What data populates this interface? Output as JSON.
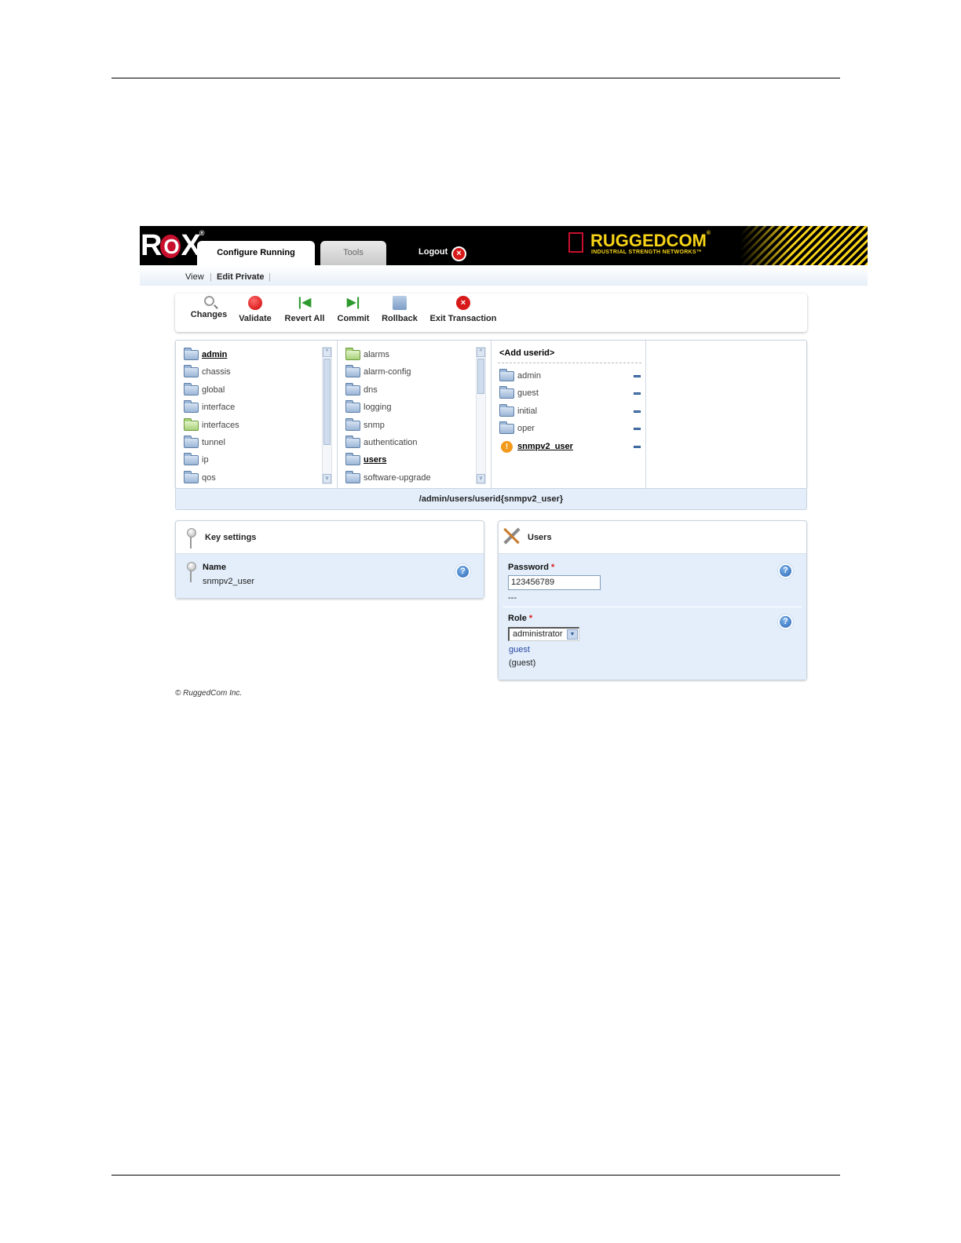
{
  "header": {
    "logo": {
      "text_left": "R",
      "text_o": "O",
      "text_right": "X",
      "mark": "®"
    },
    "tabs": [
      {
        "label": "Configure Running",
        "active": true
      },
      {
        "label": "Tools",
        "active": false
      }
    ],
    "logout_label": "Logout",
    "brand_name": "RUGGEDCOM",
    "brand_mark": "®",
    "brand_tagline": "INDUSTRIAL STRENGTH NETWORKS™"
  },
  "subnav": {
    "items": [
      "View",
      "Edit Private"
    ],
    "separator": "|"
  },
  "toolbar": {
    "buttons": [
      {
        "label": "Changes",
        "icon": "magnifier-icon"
      },
      {
        "label": "Validate",
        "icon": "validate-icon"
      },
      {
        "label": "Revert All",
        "icon": "revert-icon"
      },
      {
        "label": "Commit",
        "icon": "commit-icon"
      },
      {
        "label": "Rollback",
        "icon": "rollback-icon"
      },
      {
        "label": "Exit Transaction",
        "icon": "exit-icon"
      }
    ]
  },
  "browser": {
    "col1": [
      "admin",
      "chassis",
      "global",
      "interface",
      "interfaces",
      "tunnel",
      "ip",
      "qos"
    ],
    "col2": [
      "alarms",
      "alarm-config",
      "dns",
      "logging",
      "snmp",
      "authentication",
      "users",
      "software-upgrade"
    ],
    "col3_add": "<Add userid>",
    "col3": [
      "admin",
      "guest",
      "initial",
      "oper",
      "snmpv2_user"
    ],
    "scroll_up": "^",
    "scroll_down": "v"
  },
  "path": "/admin/users/userid{snmpv2_user}",
  "key_settings": {
    "title": "Key settings",
    "name_label": "Name",
    "name_value": "snmpv2_user"
  },
  "users": {
    "title": "Users",
    "password_label": "Password",
    "required_mark": "*",
    "password_value": "123456789",
    "password_note": "---",
    "role_label": "Role",
    "role_value": "administrator",
    "role_link": "guest",
    "role_default": "(guest)"
  },
  "help_glyph": "?",
  "copyright": "© RuggedCom Inc.",
  "colors": {
    "header_bg": "#000000",
    "brand_yellow": "#f7d417",
    "logo_red": "#c8102e",
    "panel_bg": "#e3eefa"
  }
}
